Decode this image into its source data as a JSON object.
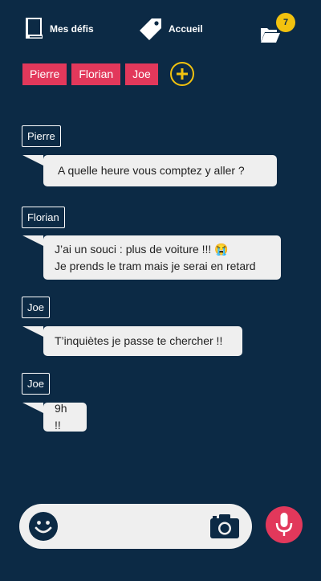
{
  "nav": {
    "mes_defis": "Mes défis",
    "accueil": "Accueil",
    "notifications": "7"
  },
  "participants": [
    "Pierre",
    "Florian",
    "Joe"
  ],
  "messages": [
    {
      "author": "Pierre",
      "lines": [
        "A quelle heure vous comptez y aller ?"
      ]
    },
    {
      "author": "Florian",
      "lines": [
        "J’ai un souci : plus de voiture !!! 😭",
        "Je prends le tram mais je serai en retard"
      ]
    },
    {
      "author": "Joe",
      "lines": [
        "T’inquiètes je passe te chercher !!"
      ]
    },
    {
      "author": "Joe",
      "lines": [
        "9h !!"
      ]
    }
  ],
  "colors": {
    "background": "#0c2a45",
    "accent": "#e2385b",
    "highlight": "#f2c20f",
    "bubble": "#efefef"
  },
  "icons": {
    "nav": [
      "book-icon",
      "tag-icon",
      "folder-icon"
    ],
    "add": "plus-icon",
    "input": [
      "emoji-icon",
      "camera-icon"
    ],
    "send": "microphone-icon"
  }
}
